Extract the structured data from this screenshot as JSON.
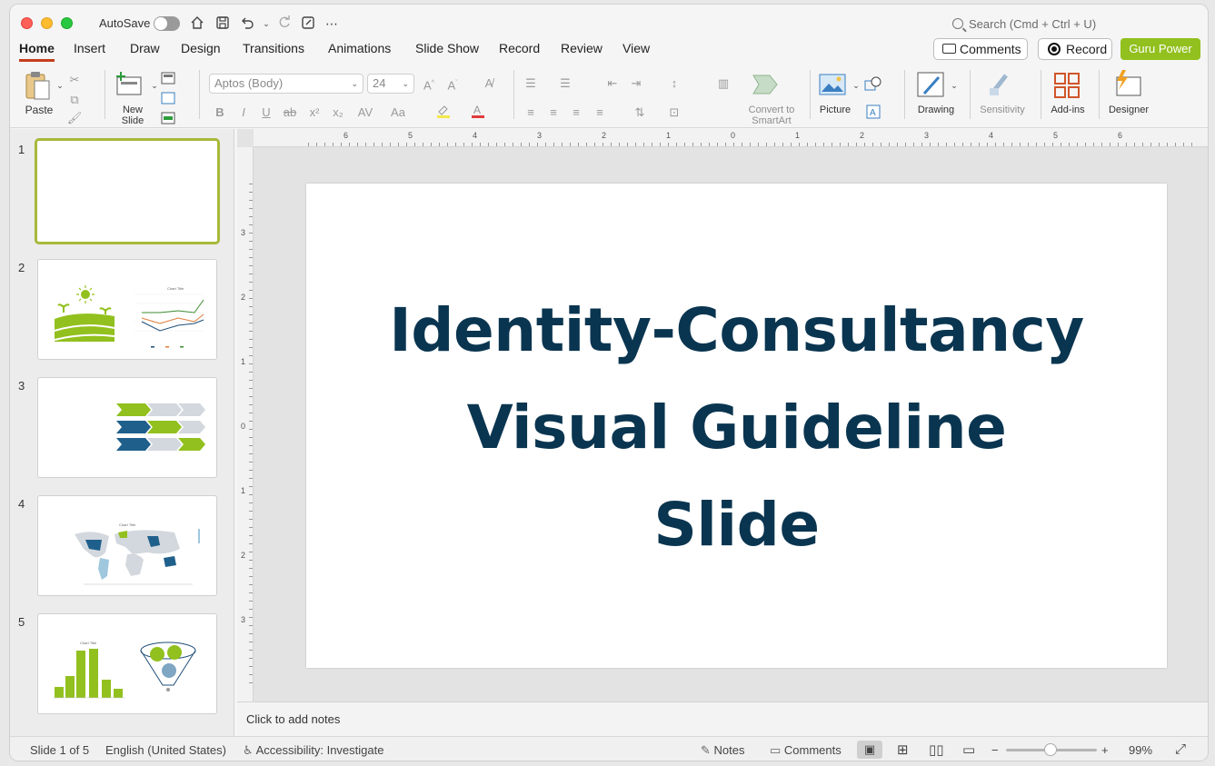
{
  "titlebar": {
    "autosave_label": "AutoSave",
    "search_placeholder": "Search (Cmd + Ctrl + U)"
  },
  "tabs": [
    {
      "label": "Home",
      "active": true
    },
    {
      "label": "Insert"
    },
    {
      "label": "Draw"
    },
    {
      "label": "Design"
    },
    {
      "label": "Transitions"
    },
    {
      "label": "Animations"
    },
    {
      "label": "Slide Show"
    },
    {
      "label": "Record"
    },
    {
      "label": "Review"
    },
    {
      "label": "View"
    }
  ],
  "header_buttons": {
    "comments": "Comments",
    "record": "Record",
    "guru": "Guru Power"
  },
  "ribbon": {
    "paste": "Paste",
    "new_slide": "New Slide",
    "font_name": "Aptos (Body)",
    "font_size": "24",
    "convert_smartart": "Convert to SmartArt",
    "picture": "Picture",
    "drawing": "Drawing",
    "sensitivity": "Sensitivity",
    "addins": "Add-ins",
    "designer": "Designer"
  },
  "slides": [
    {
      "number": "1",
      "selected": true
    },
    {
      "number": "2",
      "chart_title": "Chart Title"
    },
    {
      "number": "3"
    },
    {
      "number": "4",
      "chart_title": "Chart Title"
    },
    {
      "number": "5",
      "chart_title": "Chart Title"
    }
  ],
  "slide": {
    "title_line1": "Identity-Consultancy",
    "title_line2": "Visual Guideline",
    "title_line3": "Slide"
  },
  "ruler": {
    "h_labels": [
      "6",
      "5",
      "4",
      "3",
      "2",
      "1",
      "0",
      "1",
      "2",
      "3",
      "4",
      "5",
      "6"
    ],
    "v_labels": [
      "3",
      "2",
      "1",
      "0",
      "1",
      "2",
      "3"
    ]
  },
  "notes_placeholder": "Click to add notes",
  "status": {
    "slide_info": "Slide 1 of 5",
    "language": "English (United States)",
    "accessibility": "Accessibility: Investigate",
    "notes": "Notes",
    "comments": "Comments",
    "zoom": "99%"
  },
  "colors": {
    "accent_green": "#92c01e",
    "title_navy": "#0a3550",
    "tab_underline": "#c43e1c"
  }
}
